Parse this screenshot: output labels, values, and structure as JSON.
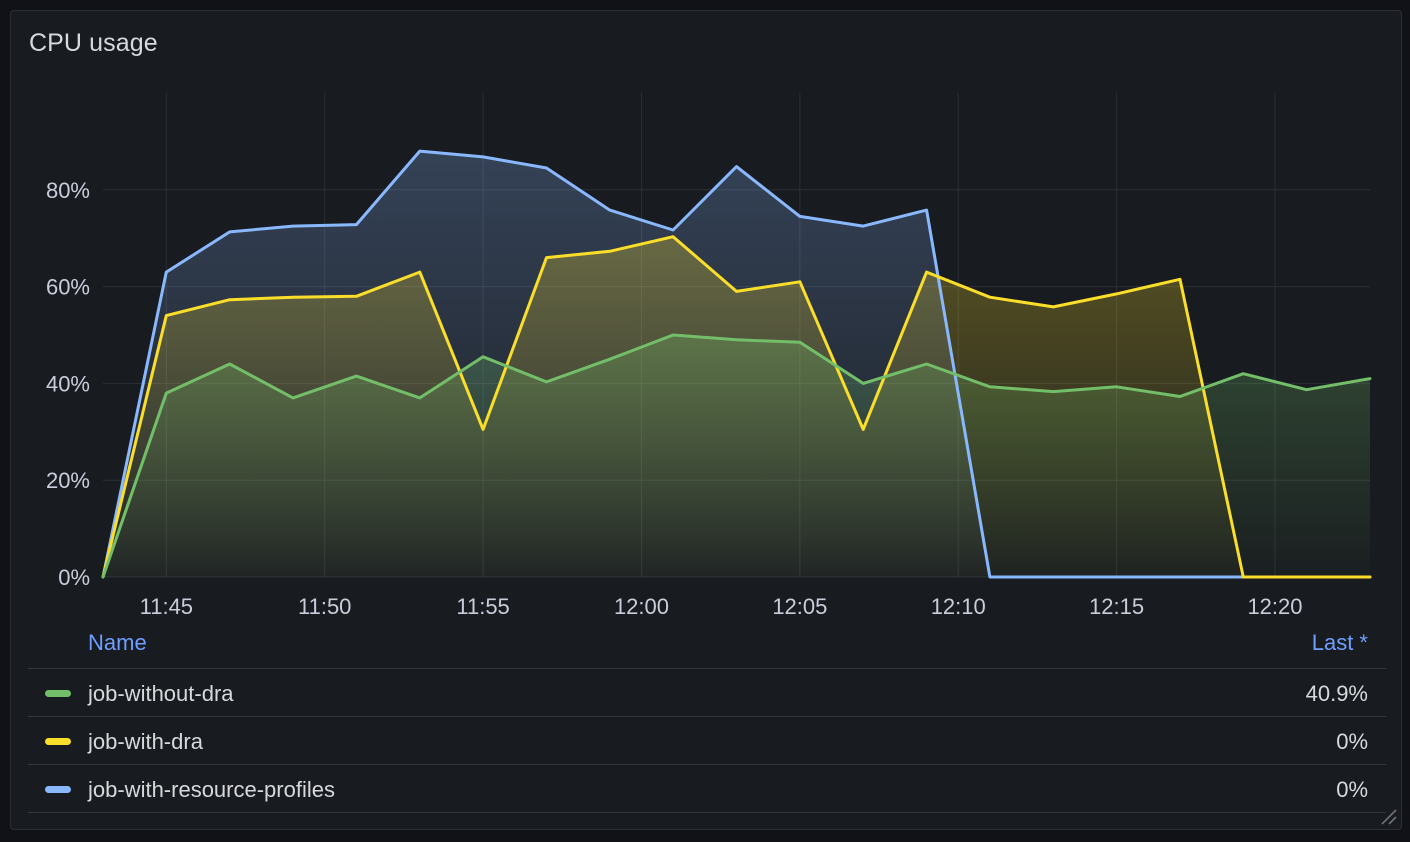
{
  "panel": {
    "title": "CPU usage"
  },
  "legend": {
    "name_header": "Name",
    "last_header": "Last *",
    "rows": [
      {
        "name": "job-without-dra",
        "last": "40.9%",
        "color": "#73bf69"
      },
      {
        "name": "job-with-dra",
        "last": "0%",
        "color": "#fade2a"
      },
      {
        "name": "job-with-resource-profiles",
        "last": "0%",
        "color": "#8ab8ff"
      }
    ]
  },
  "chart_data": {
    "type": "area",
    "title": "CPU usage",
    "xlabel": "",
    "ylabel": "",
    "x_tick_labels": [
      "11:45",
      "11:50",
      "11:55",
      "12:00",
      "12:05",
      "12:10",
      "12:15",
      "12:20"
    ],
    "x_tick_minutes": [
      105,
      110,
      115,
      120,
      125,
      130,
      135,
      140
    ],
    "y_tick_labels": [
      "0%",
      "20%",
      "40%",
      "60%",
      "80%"
    ],
    "y_ticks": [
      0,
      20,
      40,
      60,
      80
    ],
    "xlim": [
      "11:43",
      "12:23"
    ],
    "ylim": [
      0,
      100
    ],
    "grid": true,
    "legend_position": "bottom",
    "x": [
      "11:43",
      "11:45",
      "11:47",
      "11:49",
      "11:51",
      "11:53",
      "11:55",
      "11:57",
      "11:59",
      "12:01",
      "12:03",
      "12:05",
      "12:07",
      "12:09",
      "12:11",
      "12:13",
      "12:15",
      "12:17",
      "12:19",
      "12:21",
      "12:23"
    ],
    "series": [
      {
        "name": "job-without-dra",
        "color": "#73bf69",
        "values": [
          0,
          38,
          44,
          37,
          41.5,
          37,
          45.5,
          40.3,
          45,
          50,
          49,
          48.5,
          40,
          44,
          39.3,
          38.3,
          39.3,
          37.3,
          42,
          38.7,
          41
        ]
      },
      {
        "name": "job-with-dra",
        "color": "#fade2a",
        "values": [
          0,
          54,
          57.3,
          57.8,
          58,
          63,
          30.5,
          66,
          67.3,
          70.3,
          59,
          61,
          30.5,
          63,
          57.8,
          55.8,
          58.5,
          61.5,
          0,
          0,
          0
        ]
      },
      {
        "name": "job-with-resource-profiles",
        "color": "#8ab8ff",
        "values": [
          0,
          63,
          71.3,
          72.5,
          72.8,
          88,
          86.8,
          84.5,
          75.8,
          71.7,
          84.8,
          74.5,
          72.5,
          75.8,
          0,
          0,
          0,
          0,
          0,
          0,
          0
        ]
      }
    ]
  }
}
